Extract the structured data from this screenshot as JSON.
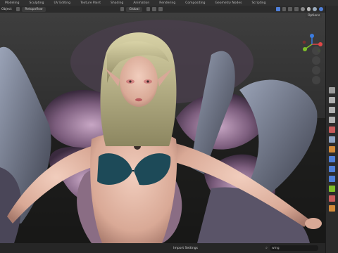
{
  "topbar": {
    "tabs": [
      "Modeling",
      "Sculpting",
      "UV Editing",
      "Texture Paint",
      "Shading",
      "Animation",
      "Rendering",
      "Compositing",
      "Geometry Nodes",
      "Scripting"
    ]
  },
  "header2": {
    "object_menu": "Object",
    "mode": "Retopoflow",
    "transform_orientation": "Global",
    "options_label": "Options"
  },
  "statusbar": {
    "center_label": "Import Settings",
    "search_value": "wing"
  },
  "colors": {
    "gizmo_x": "#e04747",
    "gizmo_y": "#7fbf2a",
    "gizmo_z": "#3b7ce0",
    "accent_blue": "#4f7fd8"
  }
}
